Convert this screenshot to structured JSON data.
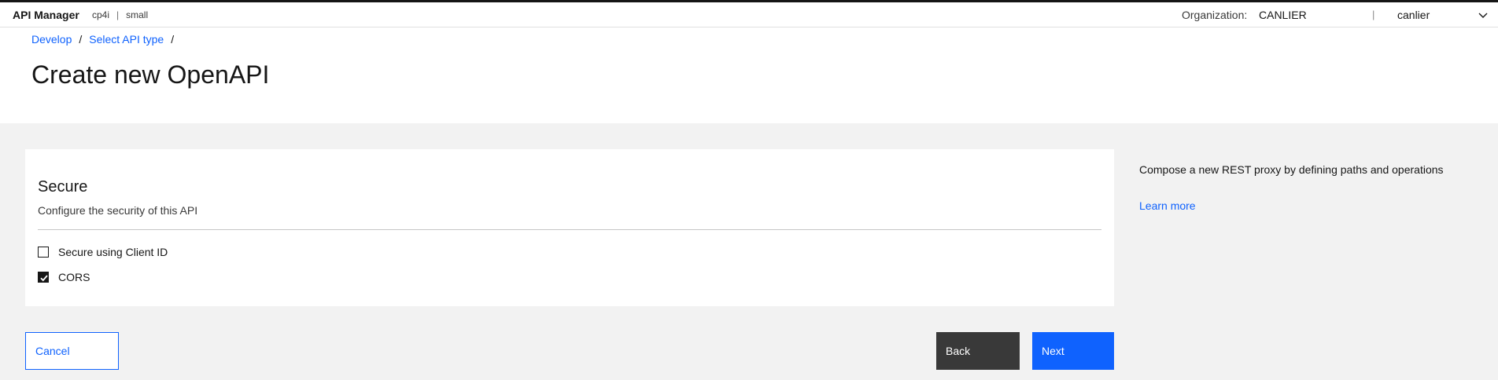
{
  "header": {
    "app_name": "API Manager",
    "context": "cp4i",
    "separator": "|",
    "size": "small",
    "org_label": "Organization:",
    "org_value": "CANLIER",
    "user_separator": "|",
    "user": "canlier"
  },
  "breadcrumb": {
    "items": [
      "Develop",
      "Select API type"
    ],
    "separator": "/"
  },
  "page": {
    "title": "Create new OpenAPI"
  },
  "secure": {
    "title": "Secure",
    "description": "Configure the security of this API",
    "options": [
      {
        "label": "Secure using Client ID",
        "checked": false
      },
      {
        "label": "CORS",
        "checked": true
      }
    ]
  },
  "side_panel": {
    "description": "Compose a new REST proxy by defining paths and operations",
    "link": "Learn more"
  },
  "actions": {
    "cancel": "Cancel",
    "back": "Back",
    "next": "Next"
  },
  "colors": {
    "accent": "#0f62fe",
    "secondary_button": "#393939",
    "background": "#f2f2f2"
  }
}
